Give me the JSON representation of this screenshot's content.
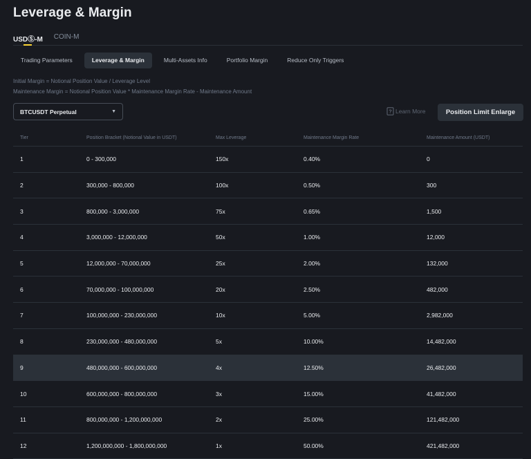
{
  "page": {
    "title": "Leverage & Margin"
  },
  "market_tabs": [
    {
      "label": "USDⓈ-M",
      "active": true
    },
    {
      "label": "COIN-M",
      "active": false
    }
  ],
  "subtabs": [
    {
      "label": "Trading Parameters",
      "active": false
    },
    {
      "label": "Leverage & Margin",
      "active": true
    },
    {
      "label": "Multi-Assets Info",
      "active": false
    },
    {
      "label": "Portfolio Margin",
      "active": false
    },
    {
      "label": "Reduce Only Triggers",
      "active": false
    }
  ],
  "formulas": {
    "initial": "Initial Margin = Notional Position Value / Leverage Level",
    "maintenance": "Maintenance Margin = Notional Position Value * Maintenance Margin Rate - Maintenance Amount"
  },
  "symbol_select": {
    "value": "BTCUSDT Perpetual"
  },
  "learn_more": "Learn More",
  "enlarge_button": "Position Limit Enlarge",
  "table": {
    "headers": {
      "tier": "Tier",
      "bracket": "Position Bracket (Notional Value in USDT)",
      "leverage": "Max Leverage",
      "rate": "Maintenance Margin Rate",
      "amount": "Maintenance Amount (USDT)"
    },
    "rows": [
      {
        "tier": "1",
        "bracket": "0 - 300,000",
        "leverage": "150x",
        "rate": "0.40%",
        "amount": "0"
      },
      {
        "tier": "2",
        "bracket": "300,000 - 800,000",
        "leverage": "100x",
        "rate": "0.50%",
        "amount": "300"
      },
      {
        "tier": "3",
        "bracket": "800,000 - 3,000,000",
        "leverage": "75x",
        "rate": "0.65%",
        "amount": "1,500"
      },
      {
        "tier": "4",
        "bracket": "3,000,000 - 12,000,000",
        "leverage": "50x",
        "rate": "1.00%",
        "amount": "12,000"
      },
      {
        "tier": "5",
        "bracket": "12,000,000 - 70,000,000",
        "leverage": "25x",
        "rate": "2.00%",
        "amount": "132,000"
      },
      {
        "tier": "6",
        "bracket": "70,000,000 - 100,000,000",
        "leverage": "20x",
        "rate": "2.50%",
        "amount": "482,000"
      },
      {
        "tier": "7",
        "bracket": "100,000,000 - 230,000,000",
        "leverage": "10x",
        "rate": "5.00%",
        "amount": "2,982,000"
      },
      {
        "tier": "8",
        "bracket": "230,000,000 - 480,000,000",
        "leverage": "5x",
        "rate": "10.00%",
        "amount": "14,482,000"
      },
      {
        "tier": "9",
        "bracket": "480,000,000 - 600,000,000",
        "leverage": "4x",
        "rate": "12.50%",
        "amount": "26,482,000",
        "highlighted": true
      },
      {
        "tier": "10",
        "bracket": "600,000,000 - 800,000,000",
        "leverage": "3x",
        "rate": "15.00%",
        "amount": "41,482,000"
      },
      {
        "tier": "11",
        "bracket": "800,000,000 - 1,200,000,000",
        "leverage": "2x",
        "rate": "25.00%",
        "amount": "121,482,000"
      },
      {
        "tier": "12",
        "bracket": "1,200,000,000 - 1,800,000,000",
        "leverage": "1x",
        "rate": "50.00%",
        "amount": "421,482,000"
      }
    ]
  },
  "colors": {
    "background": "#181a20",
    "surface": "#2b3139",
    "accent": "#fcd535",
    "text_primary": "#eaecef",
    "text_secondary": "#707a8a"
  }
}
